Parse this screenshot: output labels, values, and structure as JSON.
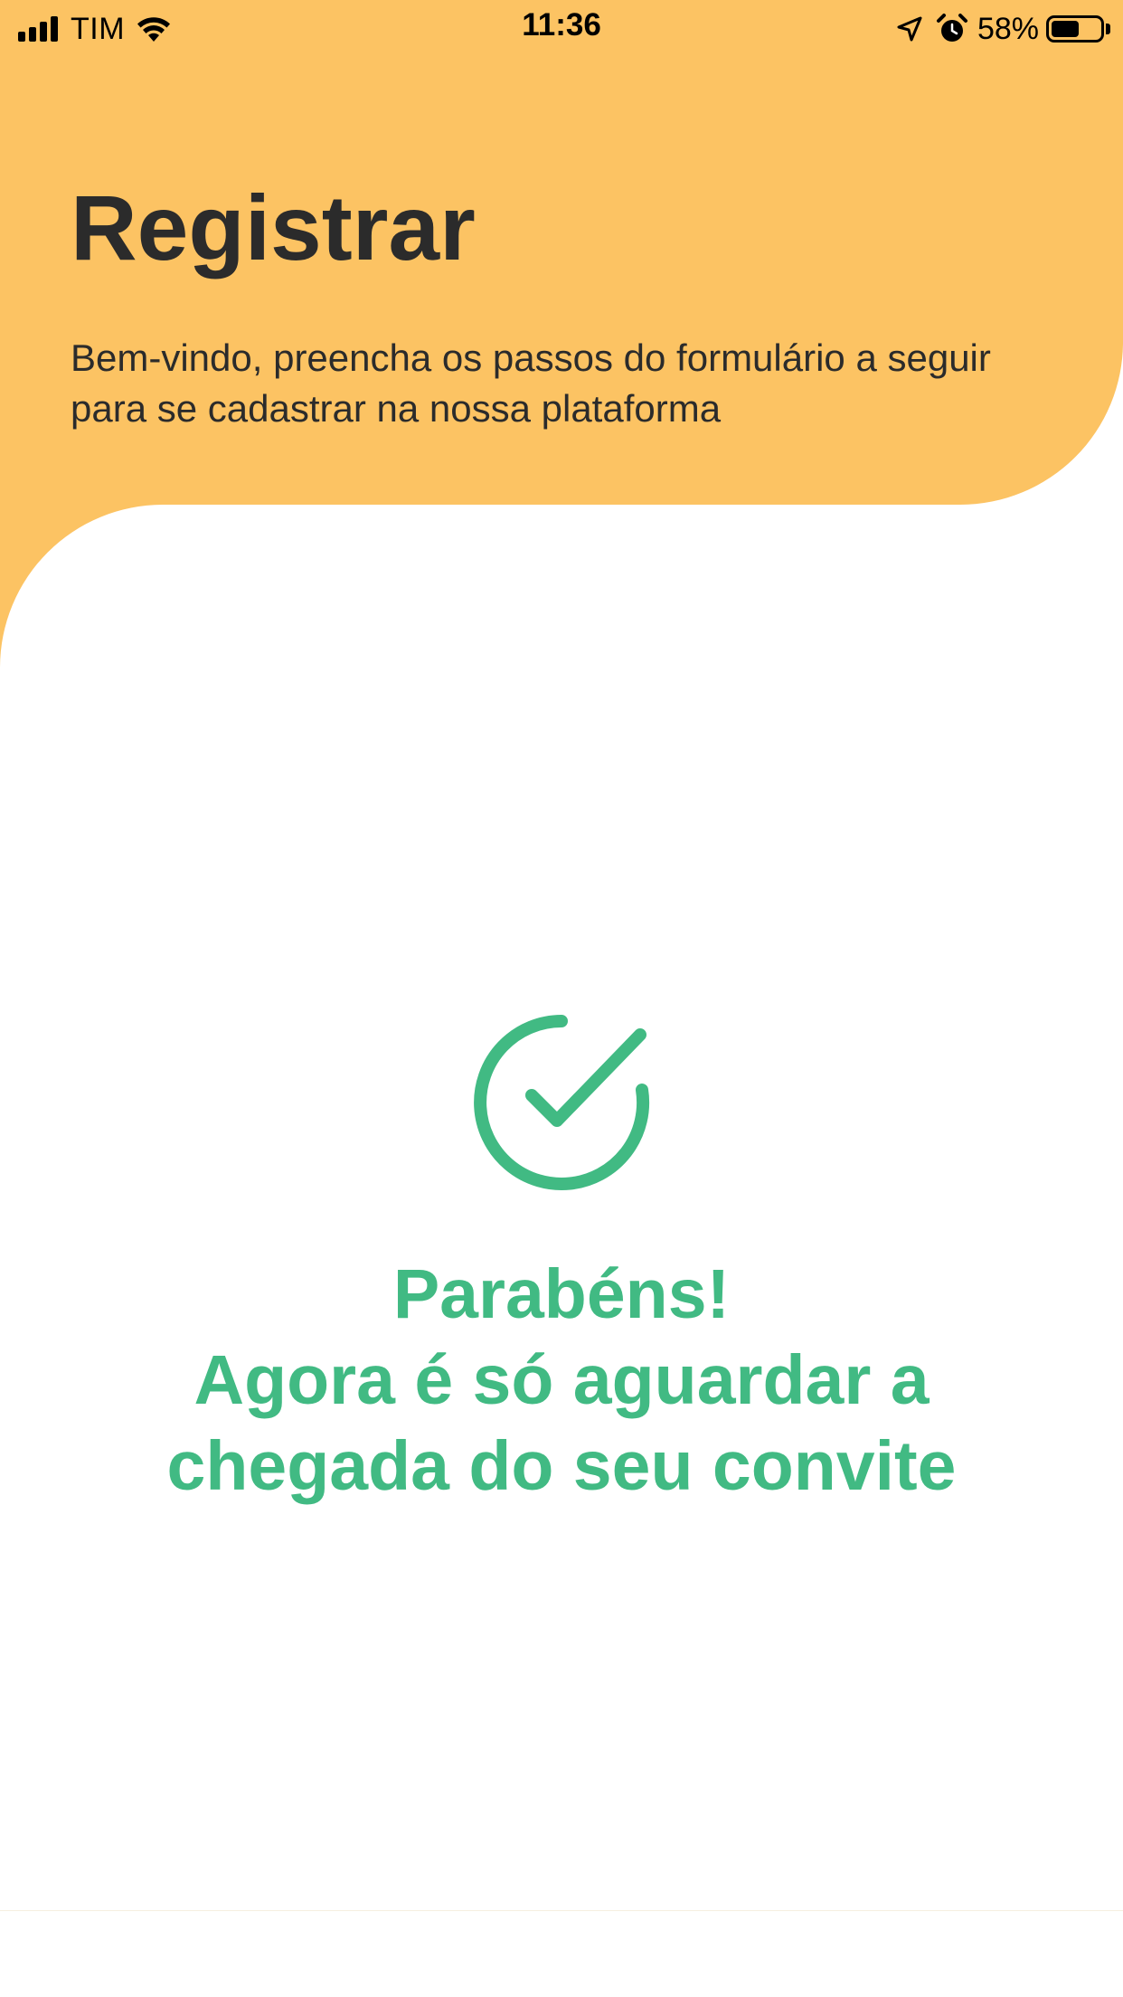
{
  "status_bar": {
    "carrier": "TIM",
    "time": "11:36",
    "battery_percent": "58%",
    "battery_level": 0.58,
    "icons": [
      "signal-icon",
      "wifi-icon",
      "location-arrow-icon",
      "alarm-icon",
      "battery-icon"
    ]
  },
  "header": {
    "title": "Registrar",
    "subtitle": "Bem-vindo, preencha os passos do formulário a seguir para se cadastrar na nossa plataforma"
  },
  "success": {
    "icon": "check-circle-icon",
    "line1": "Parabéns!",
    "line2": "Agora é só aguardar a",
    "line3": "chegada do seu convite"
  },
  "colors": {
    "header_background": "#FCC363",
    "text_dark": "#2B2B2B",
    "success_green": "#41BA83"
  }
}
